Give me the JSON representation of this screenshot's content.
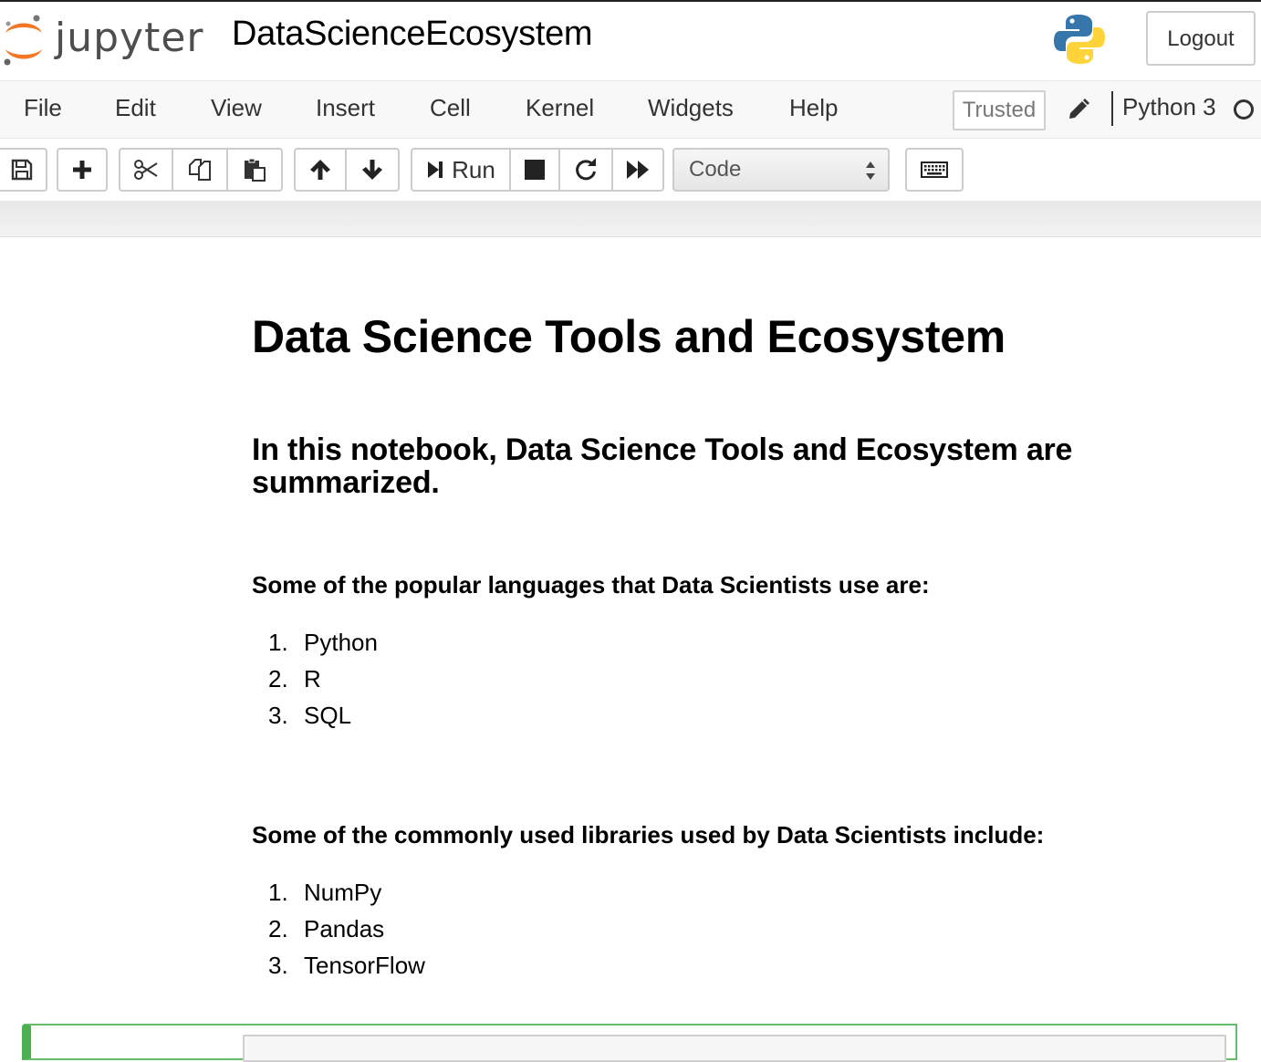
{
  "header": {
    "logo_text": "jupyter",
    "notebook_name": "DataScienceEcosystem",
    "logout_label": "Logout"
  },
  "menubar": {
    "items": [
      "File",
      "Edit",
      "View",
      "Insert",
      "Cell",
      "Kernel",
      "Widgets",
      "Help"
    ],
    "trusted_label": "Trusted",
    "kernel_name": "Python 3"
  },
  "toolbar": {
    "run_label": "Run",
    "cell_type": "Code",
    "icons": [
      "save-icon",
      "plus-icon",
      "scissors-icon",
      "copy-icon",
      "paste-icon",
      "arrow-up-icon",
      "arrow-down-icon",
      "run-icon",
      "stop-icon",
      "restart-icon",
      "fast-forward-icon",
      "keyboard-icon"
    ]
  },
  "notebook": {
    "title": "Data Science Tools and Ecosystem",
    "intro": "In this notebook, Data Science Tools and Ecosystem are summarized.",
    "languages_heading": "Some of the popular languages that Data Scientists use are:",
    "languages": [
      {
        "num": "1.",
        "text": "Python"
      },
      {
        "num": "2.",
        "text": "R"
      },
      {
        "num": "3.",
        "text": "SQL"
      }
    ],
    "libraries_heading": "Some of the commonly used libraries used by Data Scientists include:",
    "libraries": [
      {
        "num": "1.",
        "text": "NumPy"
      },
      {
        "num": "2.",
        "text": "Pandas"
      },
      {
        "num": "3.",
        "text": "TensorFlow"
      }
    ]
  },
  "colors": {
    "jupyter_orange": "#f37726",
    "active_cell_green": "#4caf50",
    "python_blue": "#3776ab",
    "python_yellow": "#ffd43b"
  }
}
